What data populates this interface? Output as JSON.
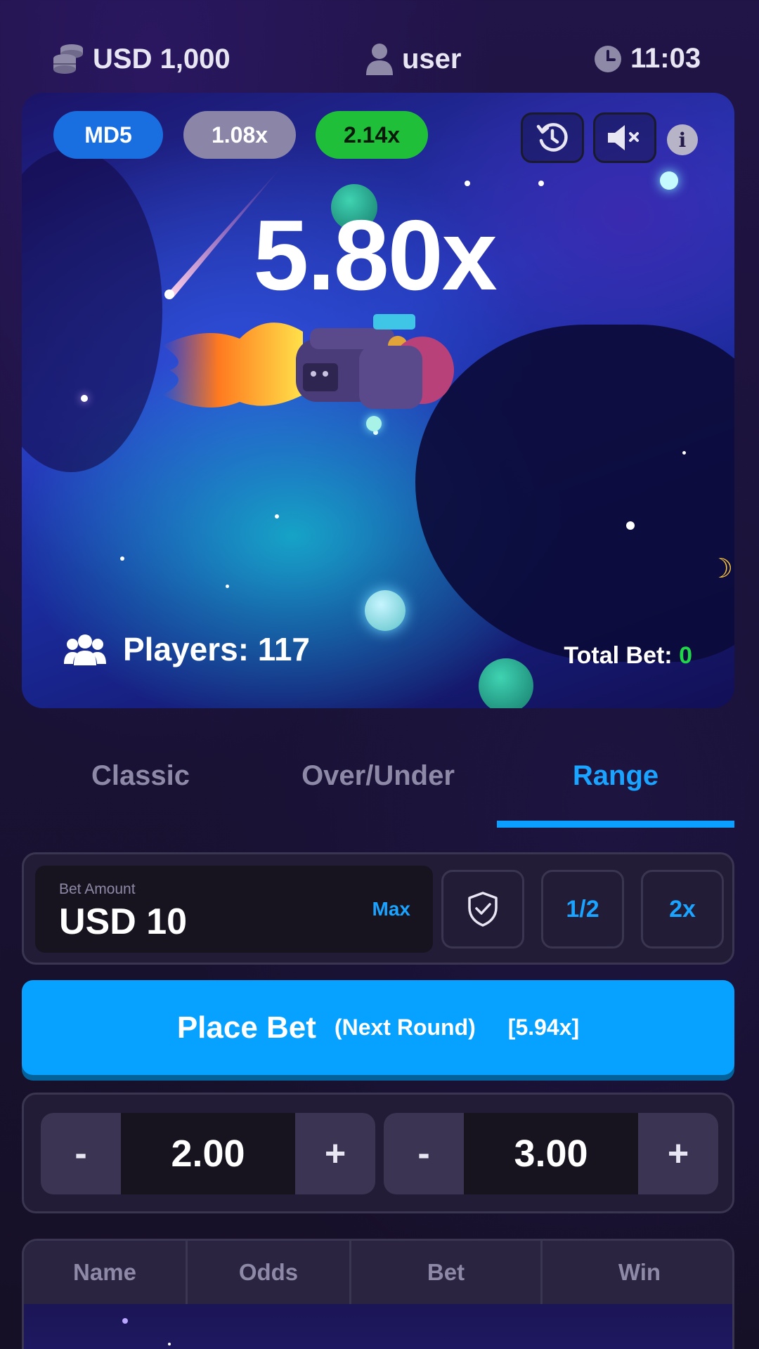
{
  "topbar": {
    "balance": "USD 1,000",
    "user": "user",
    "time": "11:03"
  },
  "game": {
    "pills": [
      {
        "label": "MD5",
        "color": "#1a6fe0"
      },
      {
        "label": "1.08x",
        "color": "#8b86a8"
      },
      {
        "label": "2.14x",
        "color": "#1fbf3a"
      }
    ],
    "multiplier": "5.80x",
    "players_label": "Players: 117",
    "total_bet_label": "Total Bet:",
    "total_bet_value": "0",
    "icons": [
      "history-icon",
      "speaker-muted-icon",
      "info-icon",
      "users-icon"
    ]
  },
  "tabs": [
    {
      "label": "Classic",
      "active": false
    },
    {
      "label": "Over/Under",
      "active": false
    },
    {
      "label": "Range",
      "active": true
    }
  ],
  "bet": {
    "label": "Bet Amount",
    "value": "USD 10",
    "max": "Max",
    "half": "1/2",
    "double": "2x"
  },
  "place_bet": {
    "label": "Place Bet",
    "sub": "(Next Round)",
    "odds": "[5.94x]"
  },
  "range": {
    "low": {
      "value": "2.00",
      "minus": "-",
      "plus": "+"
    },
    "high": {
      "value": "3.00",
      "minus": "-",
      "plus": "+"
    }
  },
  "table": {
    "headers": [
      "Name",
      "Odds",
      "Bet",
      "Win"
    ]
  },
  "colors": {
    "accent": "#07a2ff",
    "green": "#22d64a",
    "panel": "#221c36"
  }
}
